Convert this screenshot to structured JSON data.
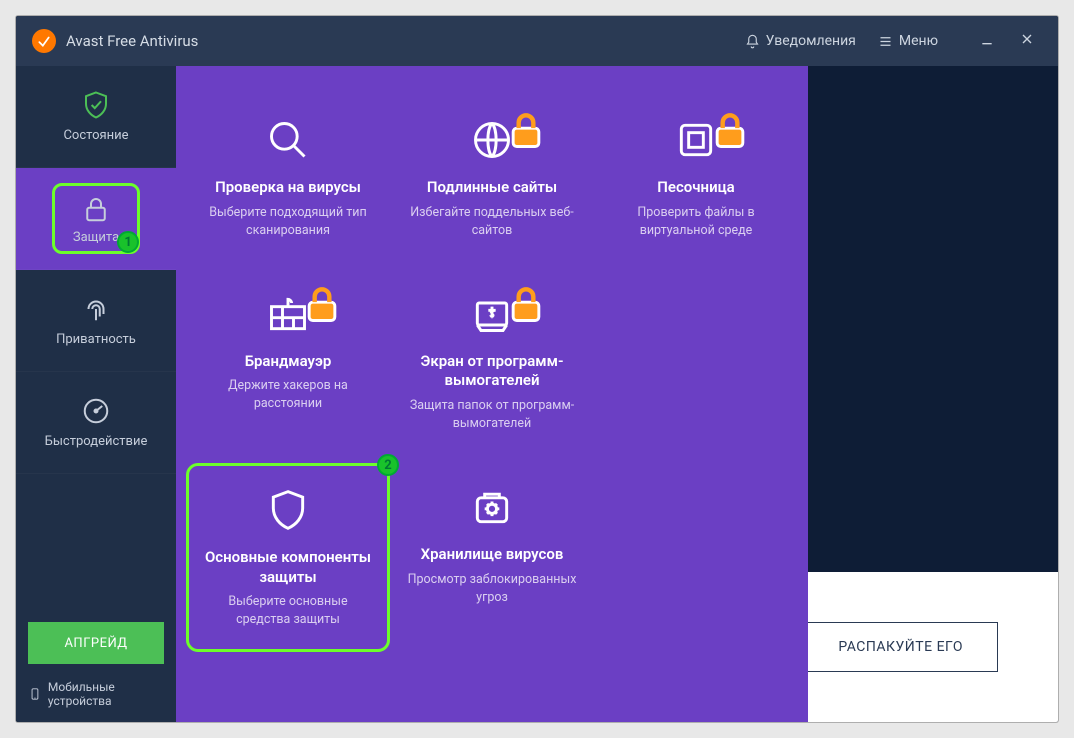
{
  "titlebar": {
    "app_name": "Avast Free Antivirus",
    "notifications": "Уведомления",
    "menu": "Меню"
  },
  "sidebar": {
    "status": "Состояние",
    "protection": "Защита",
    "privacy": "Приватность",
    "performance": "Быстродействие",
    "upgrade": "АПГРЕЙД",
    "mobile": "Мобильные устройства"
  },
  "markers": {
    "one": "1",
    "two": "2"
  },
  "tiles": {
    "virus_scan": {
      "title": "Проверка на вирусы",
      "desc": "Выберите подходящий тип сканирования",
      "locked": false
    },
    "real_sites": {
      "title": "Подлинные сайты",
      "desc": "Избегайте поддельных веб-сайтов",
      "locked": true
    },
    "sandbox": {
      "title": "Песочница",
      "desc": "Проверить файлы в виртуальной среде",
      "locked": true
    },
    "firewall": {
      "title": "Брандмауэр",
      "desc": "Держите хакеров на расстоянии",
      "locked": true
    },
    "ransomware": {
      "title": "Экран от программ-вымогателей",
      "desc": "Защита папок от программ-вымогателей",
      "locked": true
    },
    "core_shields": {
      "title": "Основные компоненты защиты",
      "desc": "Выберите основные средства защиты",
      "locked": false
    },
    "virus_chest": {
      "title": "Хранилище вирусов",
      "desc": "Просмотр заблокированных угроз",
      "locked": false
    }
  },
  "background": {
    "unpack_button": "РАСПАКУЙТЕ ЕГО"
  }
}
